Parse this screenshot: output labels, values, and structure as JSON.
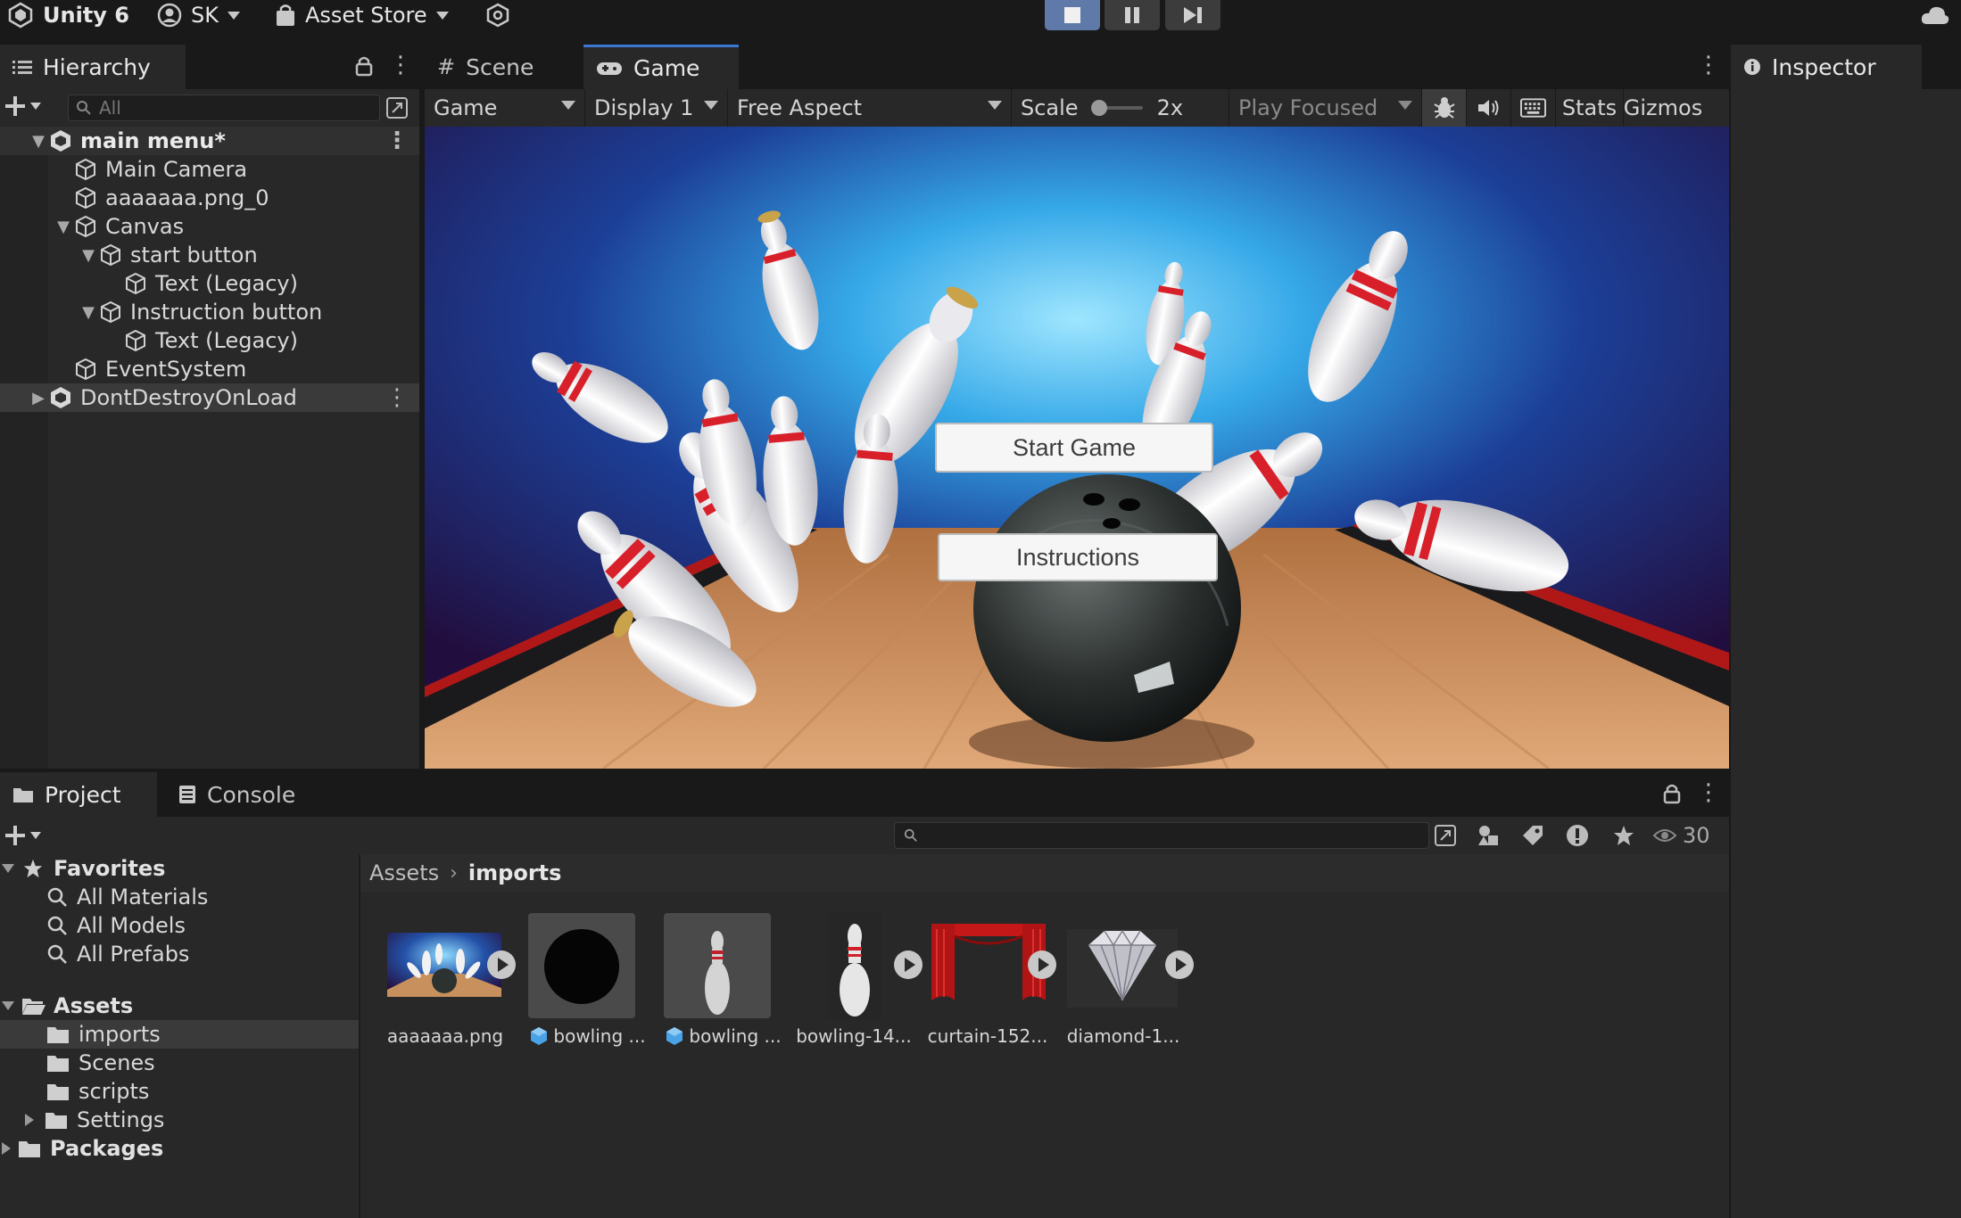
{
  "topbar": {
    "app_name": "Unity 6",
    "account": "SK",
    "asset_store": "Asset Store"
  },
  "hierarchy": {
    "tab_label": "Hierarchy",
    "search_placeholder": "All",
    "items": [
      {
        "label": "main menu*",
        "depth": 0,
        "expanded": true,
        "type": "scene"
      },
      {
        "label": "Main Camera",
        "depth": 1,
        "type": "object"
      },
      {
        "label": "aaaaaaa.png_0",
        "depth": 1,
        "type": "object"
      },
      {
        "label": "Canvas",
        "depth": 1,
        "expanded": true,
        "type": "object"
      },
      {
        "label": "start button",
        "depth": 2,
        "expanded": true,
        "type": "object"
      },
      {
        "label": "Text (Legacy)",
        "depth": 3,
        "type": "object"
      },
      {
        "label": "Instruction button",
        "depth": 2,
        "expanded": true,
        "type": "object"
      },
      {
        "label": "Text (Legacy)",
        "depth": 3,
        "type": "object"
      },
      {
        "label": "EventSystem",
        "depth": 1,
        "type": "object"
      },
      {
        "label": "DontDestroyOnLoad",
        "depth": 0,
        "expanded": false,
        "type": "scene"
      }
    ]
  },
  "center": {
    "tabs": [
      "Scene",
      "Game"
    ],
    "toolbar": {
      "view": "Game",
      "display": "Display 1",
      "aspect": "Free Aspect",
      "scale_label": "Scale",
      "scale_value": "2x",
      "play_mode": "Play Focused",
      "stats": "Stats",
      "gizmos": "Gizmos"
    },
    "game_buttons": {
      "start": "Start Game",
      "instructions": "Instructions"
    }
  },
  "inspector": {
    "tab_label": "Inspector"
  },
  "project": {
    "tabs": [
      "Project",
      "Console"
    ],
    "visible_count": "30",
    "favorites_label": "Favorites",
    "favorites": [
      "All Materials",
      "All Models",
      "All Prefabs"
    ],
    "assets_label": "Assets",
    "asset_folders": [
      "imports",
      "Scenes",
      "scripts",
      "Settings"
    ],
    "packages_label": "Packages",
    "breadcrumb": [
      "Assets",
      "imports"
    ],
    "files": [
      {
        "label": "aaaaaaa.png",
        "icon": "image-thumbnail"
      },
      {
        "label": "bowling ...",
        "icon": "prefab-cube-icon"
      },
      {
        "label": "bowling ...",
        "icon": "prefab-cube-icon"
      },
      {
        "label": "bowling-14...",
        "icon": "image-thumbnail"
      },
      {
        "label": "curtain-152...",
        "icon": "image-thumbnail"
      },
      {
        "label": "diamond-1...",
        "icon": "image-thumbnail"
      }
    ]
  },
  "colors": {
    "accent": "#3a78d4",
    "play_active": "#5f7aa8",
    "panel": "#282828",
    "background": "#191919"
  }
}
